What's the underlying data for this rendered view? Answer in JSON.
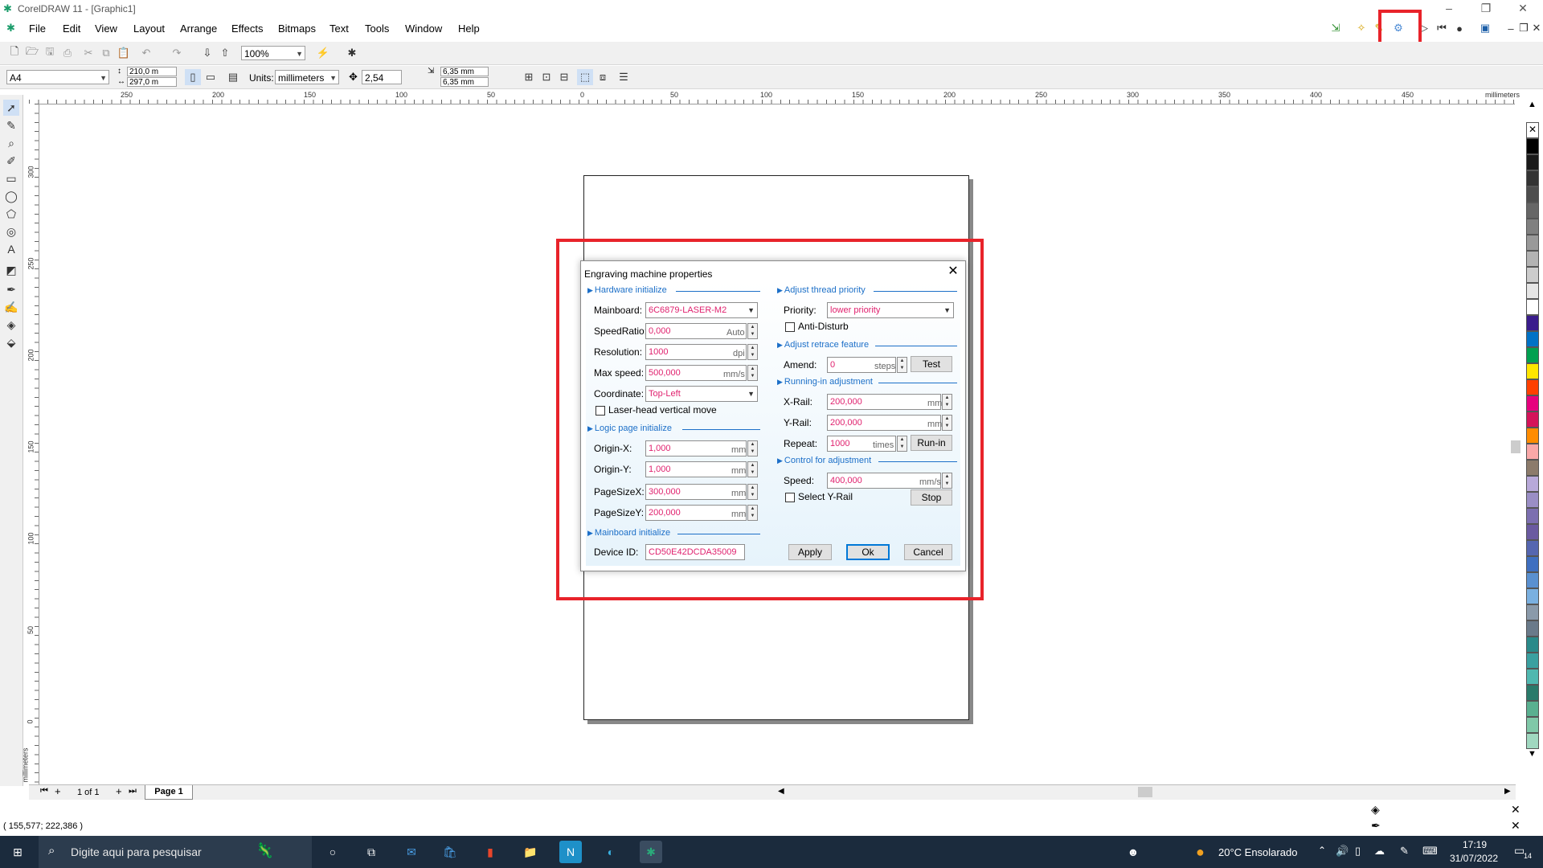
{
  "window": {
    "title": "CorelDRAW 11 - [Graphic1]"
  },
  "menu": [
    "File",
    "Edit",
    "View",
    "Layout",
    "Arrange",
    "Effects",
    "Bitmaps",
    "Text",
    "Tools",
    "Window",
    "Help"
  ],
  "toolbar": {
    "zoom": "100%"
  },
  "property_bar": {
    "paper": "A4",
    "width": "210,0 m",
    "height": "297,0 m",
    "units_label": "Units:",
    "units": "millimeters",
    "nudge": "2,54 mm",
    "dup_x": "6,35 mm",
    "dup_y": "6,35 mm"
  },
  "ruler": {
    "h_ticks": [
      "250",
      "200",
      "150",
      "100",
      "50",
      "0",
      "50",
      "100",
      "150",
      "200",
      "250",
      "300",
      "350",
      "400",
      "450"
    ],
    "h_unit": "millimeters",
    "v_ticks": [
      "300",
      "250",
      "200",
      "150",
      "100",
      "50",
      "0"
    ],
    "v_unit": "millimeters"
  },
  "dialog": {
    "title": "Engraving machine properties",
    "hardware": {
      "section": "Hardware initialize",
      "mainboard_label": "Mainboard:",
      "mainboard": "6C6879-LASER-M2",
      "speedratio_label": "SpeedRatio:",
      "speedratio": "0,000",
      "speedratio_unit": "Auto",
      "resolution_label": "Resolution:",
      "resolution": "1000",
      "resolution_unit": "dpi",
      "maxspeed_label": "Max speed:",
      "maxspeed": "500,000",
      "maxspeed_unit": "mm/s",
      "coordinate_label": "Coordinate:",
      "coordinate": "Top-Left",
      "laserhead_label": "Laser-head vertical move"
    },
    "logic": {
      "section": "Logic page initialize",
      "originx_label": "Origin-X:",
      "originx": "1,000",
      "originy_label": "Origin-Y:",
      "originy": "1,000",
      "pagesizex_label": "PageSizeX:",
      "pagesizex": "300,000",
      "pagesizey_label": "PageSizeY:",
      "pagesizey": "200,000",
      "unit": "mm"
    },
    "mainboard": {
      "section": "Mainboard initialize",
      "deviceid_label": "Device ID:",
      "deviceid": "CD50E42DCDA35009"
    },
    "thread": {
      "section": "Adjust thread priority",
      "priority_label": "Priority:",
      "priority": "lower priority",
      "antidisturb_label": "Anti-Disturb"
    },
    "retrace": {
      "section": "Adjust retrace feature",
      "amend_label": "Amend:",
      "amend": "0",
      "amend_unit": "steps",
      "test_button": "Test"
    },
    "runin": {
      "section": "Running-in adjustment",
      "xrail_label": "X-Rail:",
      "xrail": "200,000",
      "yrail_label": "Y-Rail:",
      "yrail": "200,000",
      "unit": "mm",
      "repeat_label": "Repeat:",
      "repeat": "1000",
      "repeat_unit": "times",
      "runin_button": "Run-in"
    },
    "control": {
      "section": "Control for adjustment",
      "speed_label": "Speed:",
      "speed": "400,000",
      "speed_unit": "mm/s",
      "selectyrail_label": "Select Y-Rail",
      "stop_button": "Stop"
    },
    "buttons": {
      "apply": "Apply",
      "ok": "Ok",
      "cancel": "Cancel"
    }
  },
  "pagetabs": {
    "counter": "1 of 1",
    "tab": "Page 1"
  },
  "status": {
    "coords": "( 155,577; 222,386 )"
  },
  "taskbar": {
    "search_placeholder": "Digite aqui para pesquisar",
    "weather": "20°C  Ensolarado",
    "time": "17:19",
    "date": "31/07/2022",
    "notifications": "14"
  },
  "colors": {
    "accent": "#1c6fc8",
    "field_text": "#e0216e",
    "highlight": "#e8232a"
  }
}
